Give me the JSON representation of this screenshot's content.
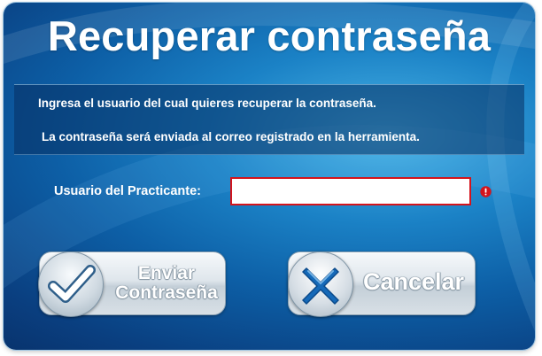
{
  "dialog": {
    "title": "Recuperar contraseña",
    "info_line_1": "Ingresa el usuario del cual quieres recuperar la contraseña.",
    "info_line_2": "La contraseña será enviada al correo registrado en la herramienta."
  },
  "form": {
    "username_label": "Usuario del Practicante:",
    "username_value": "",
    "validation_state": "error",
    "validation_icon": "error-icon"
  },
  "buttons": {
    "send_label_line_1": "Enviar",
    "send_label_line_2": "Contraseña",
    "send_icon": "checkmark-icon",
    "cancel_label": "Cancelar",
    "cancel_icon": "x-icon"
  },
  "colors": {
    "accent_error": "#d4141c",
    "background_blue": "#0d5fa6",
    "text": "#ffffff"
  }
}
